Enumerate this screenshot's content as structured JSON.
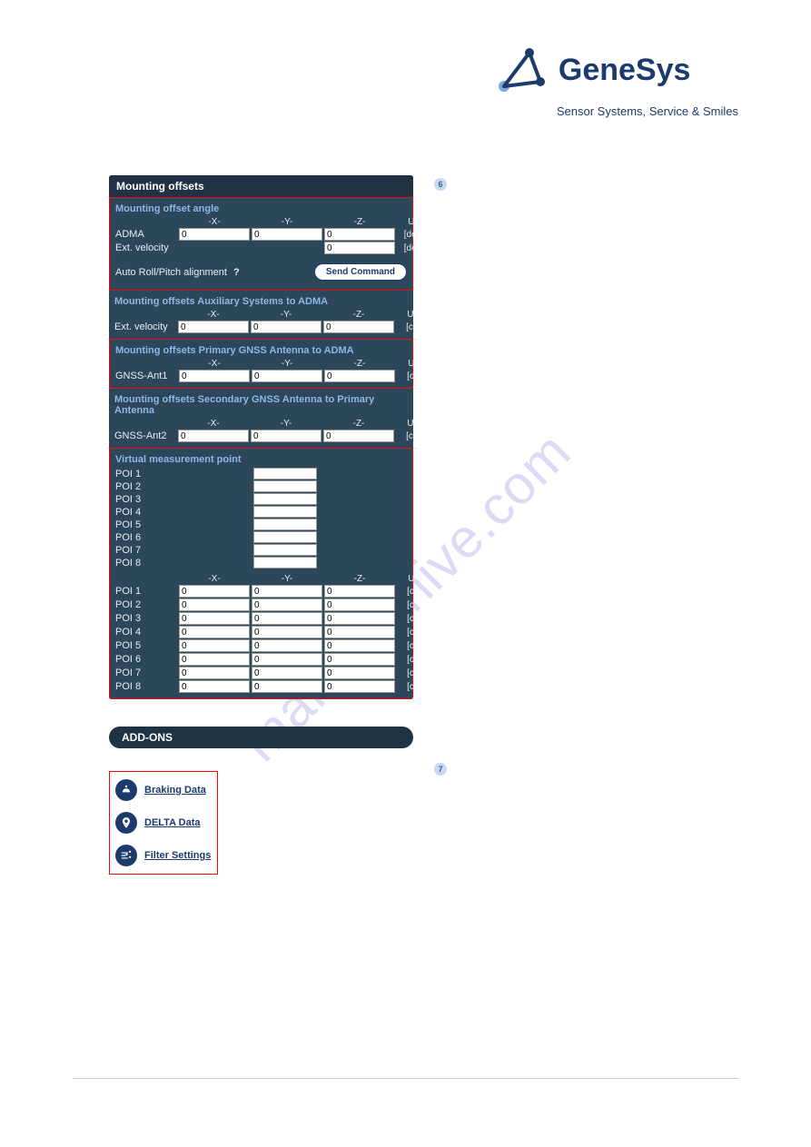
{
  "brand": {
    "name": "GeneSys",
    "tagline": "Sensor Systems, Service & Smiles"
  },
  "badges": {
    "six": "6",
    "seven": "7"
  },
  "panel": {
    "title": "Mounting offsets",
    "headers": {
      "x": "-X-",
      "y": "-Y-",
      "z": "-Z-",
      "unit": "Unit"
    },
    "angle": {
      "title": "Mounting offset angle",
      "rows": {
        "adma": {
          "label": "ADMA",
          "x": "0",
          "y": "0",
          "z": "0",
          "unit": "[deg]"
        },
        "extvel": {
          "label": "Ext. velocity",
          "x": "",
          "y": "",
          "z": "0",
          "unit": "[deg]"
        }
      },
      "auto_label": "Auto Roll/Pitch alignment",
      "help": "?",
      "button": "Send Command"
    },
    "aux": {
      "title": "Mounting offsets Auxiliary Systems to ADMA",
      "row": {
        "label": "Ext. velocity",
        "x": "0",
        "y": "0",
        "z": "0",
        "unit": "[cm]"
      }
    },
    "gnss1": {
      "title": "Mounting offsets Primary GNSS Antenna to ADMA",
      "row": {
        "label": "GNSS-Ant1",
        "x": "0",
        "y": "0",
        "z": "0",
        "unit": "[cm]"
      }
    },
    "gnss2": {
      "title": "Mounting offsets Secondary GNSS Antenna to Primary Antenna",
      "row": {
        "label": "GNSS-Ant2",
        "x": "0",
        "y": "0",
        "z": "0",
        "unit": "[cm]"
      }
    },
    "vmp": {
      "title": "Virtual measurement point",
      "poi_labels": [
        "POI 1",
        "POI 2",
        "POI 3",
        "POI 4",
        "POI 5",
        "POI 6",
        "POI 7",
        "POI 8"
      ],
      "poi_names": [
        "",
        "",
        "",
        "",
        "",
        "",
        "",
        ""
      ],
      "coords": [
        {
          "label": "POI 1",
          "x": "0",
          "y": "0",
          "z": "0",
          "unit": "[cm]"
        },
        {
          "label": "POI 2",
          "x": "0",
          "y": "0",
          "z": "0",
          "unit": "[cm]"
        },
        {
          "label": "POI 3",
          "x": "0",
          "y": "0",
          "z": "0",
          "unit": "[cm]"
        },
        {
          "label": "POI 4",
          "x": "0",
          "y": "0",
          "z": "0",
          "unit": "[cm]"
        },
        {
          "label": "POI 5",
          "x": "0",
          "y": "0",
          "z": "0",
          "unit": "[cm]"
        },
        {
          "label": "POI 6",
          "x": "0",
          "y": "0",
          "z": "0",
          "unit": "[cm]"
        },
        {
          "label": "POI 7",
          "x": "0",
          "y": "0",
          "z": "0",
          "unit": "[cm]"
        },
        {
          "label": "POI 8",
          "x": "0",
          "y": "0",
          "z": "0",
          "unit": "[cm]"
        }
      ]
    }
  },
  "addons": {
    "title": "ADD-ONS",
    "items": [
      {
        "label": "Braking Data"
      },
      {
        "label": "DELTA Data"
      },
      {
        "label": "Filter Settings"
      }
    ]
  },
  "watermark": "manualshive.com"
}
